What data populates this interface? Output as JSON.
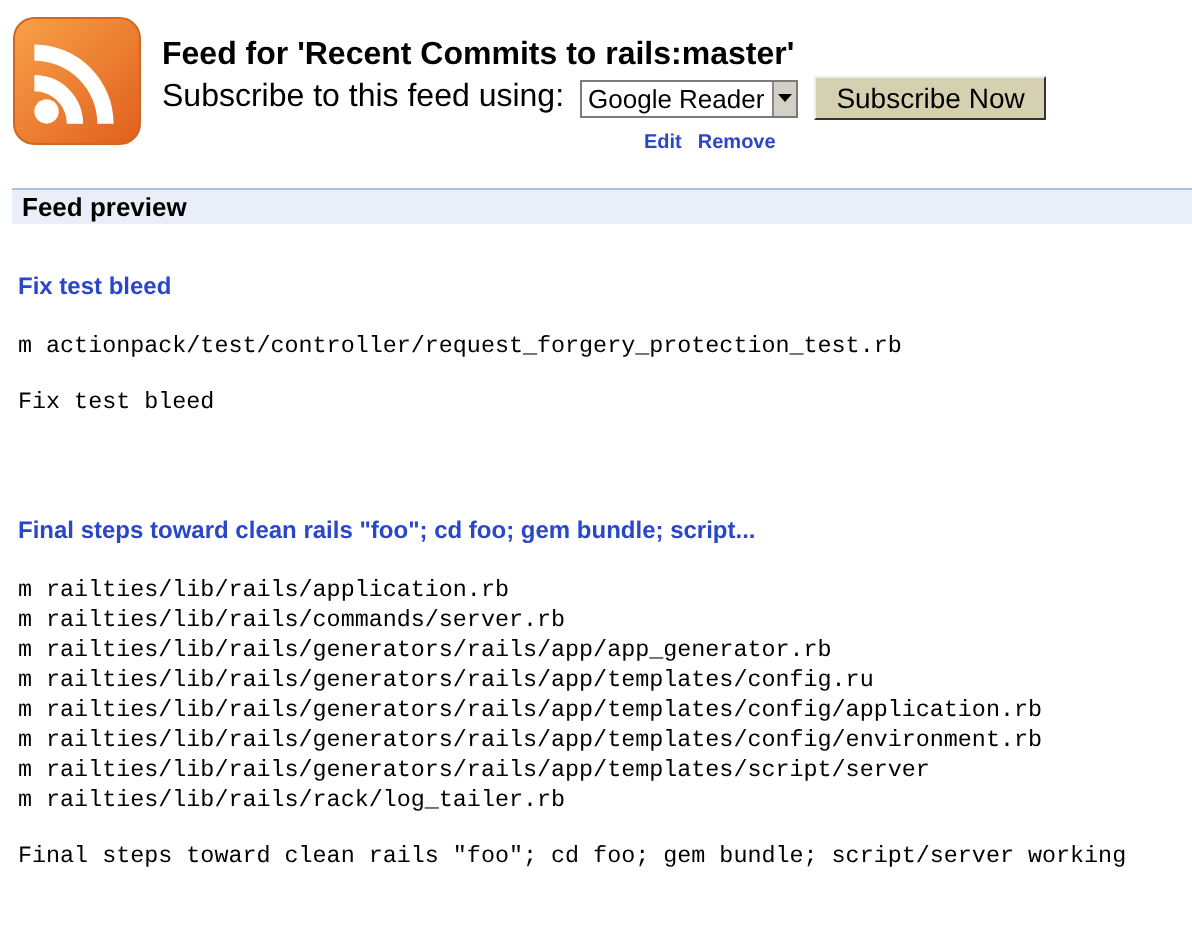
{
  "header": {
    "title": "Feed for 'Recent Commits to rails:master'",
    "subscribe_label": "Subscribe to this feed using:",
    "reader_select": "Google Reader",
    "subscribe_button": "Subscribe Now",
    "links": [
      "Edit",
      "Remove"
    ]
  },
  "preview": {
    "heading": "Feed preview"
  },
  "items": [
    {
      "title": "Fix test bleed",
      "files": [
        "m actionpack/test/controller/request_forgery_protection_test.rb"
      ],
      "message": "Fix test bleed"
    },
    {
      "title": "Final steps toward clean rails \"foo\"; cd foo; gem bundle; script...",
      "files": [
        "m railties/lib/rails/application.rb",
        "m railties/lib/rails/commands/server.rb",
        "m railties/lib/rails/generators/rails/app/app_generator.rb",
        "m railties/lib/rails/generators/rails/app/templates/config.ru",
        "m railties/lib/rails/generators/rails/app/templates/config/application.rb",
        "m railties/lib/rails/generators/rails/app/templates/config/environment.rb",
        "m railties/lib/rails/generators/rails/app/templates/script/server",
        "m railties/lib/rails/rack/log_tailer.rb"
      ],
      "message": "Final steps toward clean rails \"foo\"; cd foo; gem bundle; script/server working"
    }
  ]
}
